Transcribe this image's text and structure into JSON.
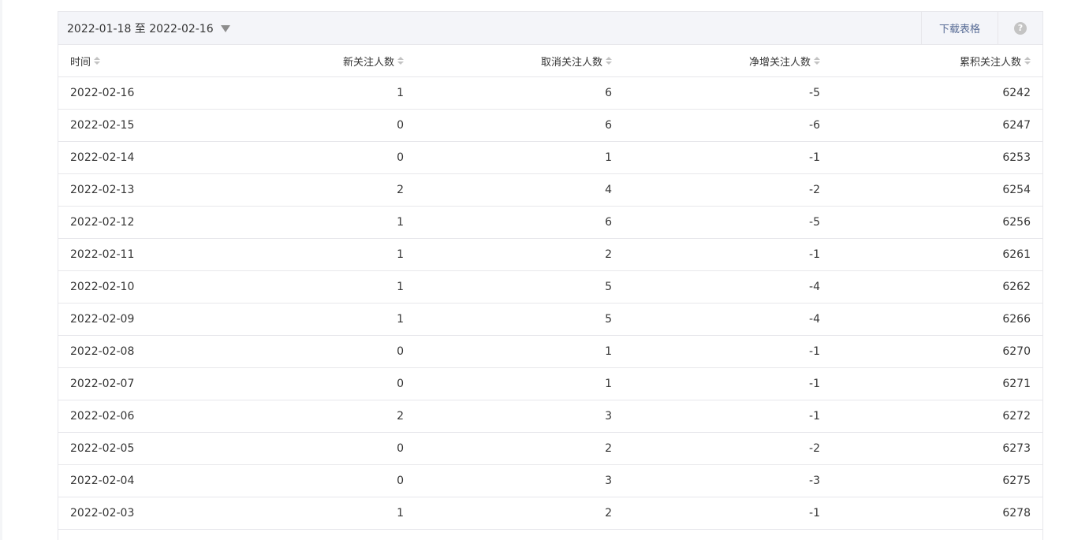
{
  "toolbar": {
    "date_range": "2022-01-18 至 2022-02-16",
    "download_label": "下载表格",
    "help_label": "?"
  },
  "table": {
    "headers": [
      "时间",
      "新关注人数",
      "取消关注人数",
      "净增关注人数",
      "累积关注人数"
    ],
    "rows": [
      [
        "2022-02-16",
        "1",
        "6",
        "-5",
        "6242"
      ],
      [
        "2022-02-15",
        "0",
        "6",
        "-6",
        "6247"
      ],
      [
        "2022-02-14",
        "0",
        "1",
        "-1",
        "6253"
      ],
      [
        "2022-02-13",
        "2",
        "4",
        "-2",
        "6254"
      ],
      [
        "2022-02-12",
        "1",
        "6",
        "-5",
        "6256"
      ],
      [
        "2022-02-11",
        "1",
        "2",
        "-1",
        "6261"
      ],
      [
        "2022-02-10",
        "1",
        "5",
        "-4",
        "6262"
      ],
      [
        "2022-02-09",
        "1",
        "5",
        "-4",
        "6266"
      ],
      [
        "2022-02-08",
        "0",
        "1",
        "-1",
        "6270"
      ],
      [
        "2022-02-07",
        "0",
        "1",
        "-1",
        "6271"
      ],
      [
        "2022-02-06",
        "2",
        "3",
        "-1",
        "6272"
      ],
      [
        "2022-02-05",
        "0",
        "2",
        "-2",
        "6273"
      ],
      [
        "2022-02-04",
        "0",
        "3",
        "-3",
        "6275"
      ],
      [
        "2022-02-03",
        "1",
        "2",
        "-1",
        "6278"
      ]
    ]
  },
  "colors": {
    "link": "#576b95",
    "border": "#e7e7eb",
    "toolbar_bg": "#f4f5f9",
    "text": "#353535"
  }
}
